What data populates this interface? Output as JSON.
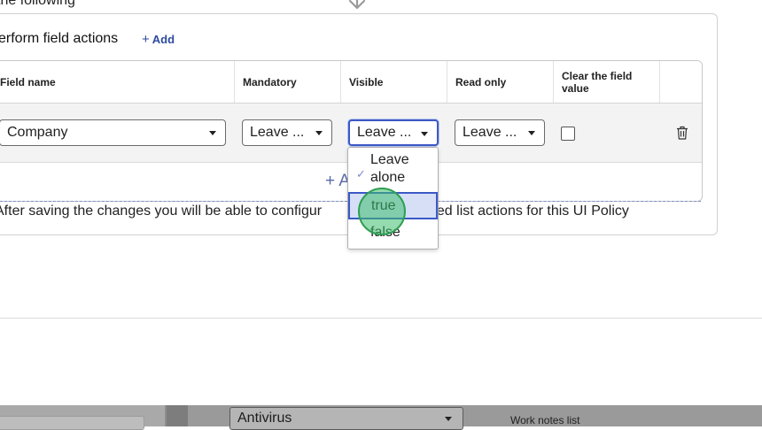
{
  "header": {
    "previous_heading": "the following"
  },
  "section": {
    "title": "erform field actions",
    "add_label": "Add",
    "add_plus": "+"
  },
  "table": {
    "columns": [
      "Field name",
      "Mandatory",
      "Visible",
      "Read only",
      "Clear the field value"
    ],
    "row": {
      "field_name": "Company",
      "mandatory": "Leave ...",
      "visible": "Leave ...",
      "read_only": "Leave ...",
      "clear_checked": false
    },
    "add_row_label": "+ A"
  },
  "dropdown": {
    "options": [
      "Leave alone",
      "true",
      "false"
    ],
    "checked_option": "Leave alone",
    "highlighted_option": "true"
  },
  "note": {
    "part1": "After saving the changes you will be able to configur",
    "part2": "elated list actions for this UI Policy"
  },
  "background": {
    "select_value": "Antivirus",
    "label": "Work notes list"
  },
  "colors": {
    "accent": "#3b59c6",
    "link": "#2e4a9e",
    "click_marker": "#3cbe6e"
  },
  "icons": {
    "arrow": "arrow-down-icon",
    "caret": "caret-down-icon",
    "trash": "trash-icon",
    "check": "check-icon"
  }
}
